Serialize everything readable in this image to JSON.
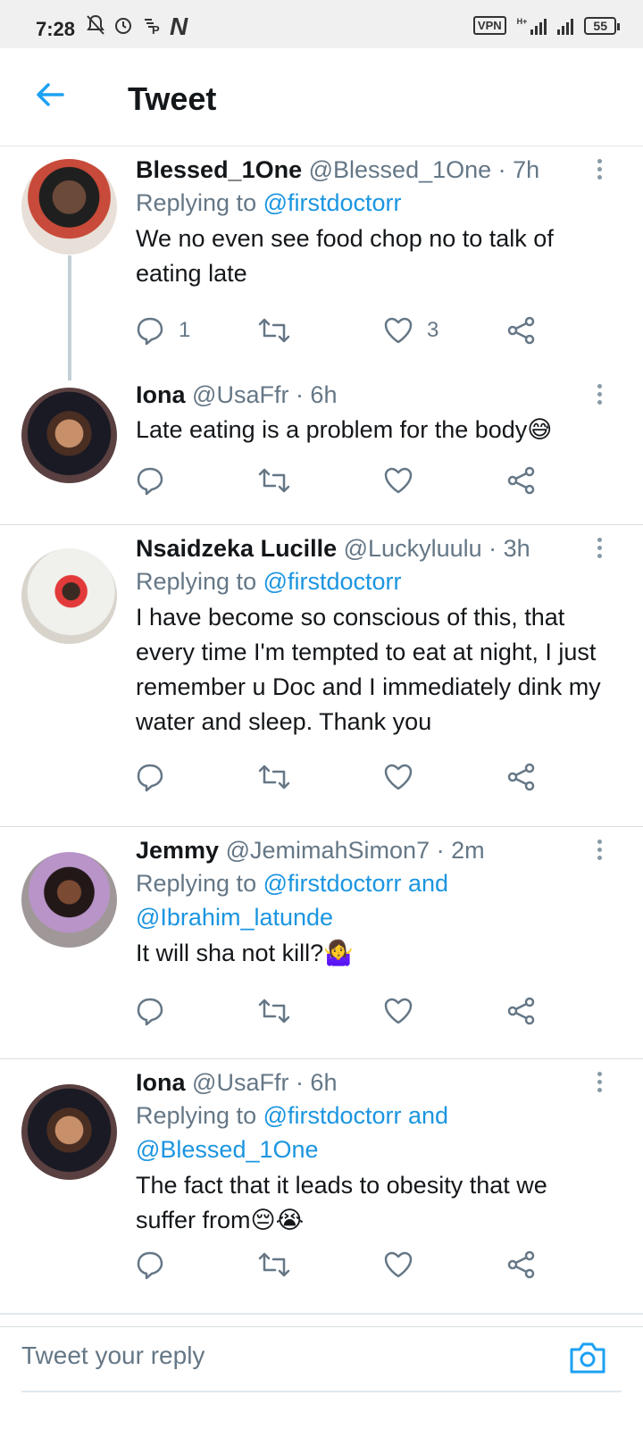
{
  "status_bar": {
    "time": "7:28",
    "vpn": "VPN",
    "network": "H+",
    "battery": "55"
  },
  "header": {
    "title": "Tweet",
    "back_icon": "arrow-left-icon"
  },
  "colors": {
    "accent": "#1da1f2",
    "link": "#1b95e0",
    "muted": "#657786",
    "divider": "#e1e8ed"
  },
  "tweets": [
    {
      "name": "Blessed_1One",
      "meta": "@Blessed_1One · 7h",
      "replying_prefix": "Replying to ",
      "replying_to": "@firstdoctorr",
      "text": "We no even see food chop no to talk of eating late",
      "reply_count": "1",
      "like_count": "3"
    },
    {
      "name": "Iona",
      "meta": "@UsaFfr · 6h",
      "text": "Late eating is a problem for the body😅",
      "reply_count": "",
      "like_count": ""
    },
    {
      "name": "Nsaidzeka Lucille",
      "meta": "@Luckyluulu · 3h",
      "replying_prefix": "Replying to ",
      "replying_to": "@firstdoctorr",
      "text": "I have become so conscious of this, that every time I'm tempted to eat at night, I just remember u Doc and I immediately dink my water and sleep. Thank you",
      "reply_count": "",
      "like_count": ""
    },
    {
      "name": "Jemmy",
      "meta": "@JemimahSimon7 · 2m",
      "replying_prefix": "Replying to ",
      "replying_to": "@firstdoctorr and @Ibrahim_latunde",
      "text": "It will sha not kill?🤷‍♀️",
      "reply_count": "",
      "like_count": ""
    },
    {
      "name": "Iona",
      "meta": "@UsaFfr · 6h",
      "replying_prefix": "Replying to ",
      "replying_to": "@firstdoctorr and @Blessed_1One",
      "text": "The fact that it leads to obesity that we suffer from😔😭",
      "reply_count": "",
      "like_count": ""
    }
  ],
  "reply_bar": {
    "placeholder": "Tweet your reply",
    "camera_icon": "camera-icon"
  }
}
